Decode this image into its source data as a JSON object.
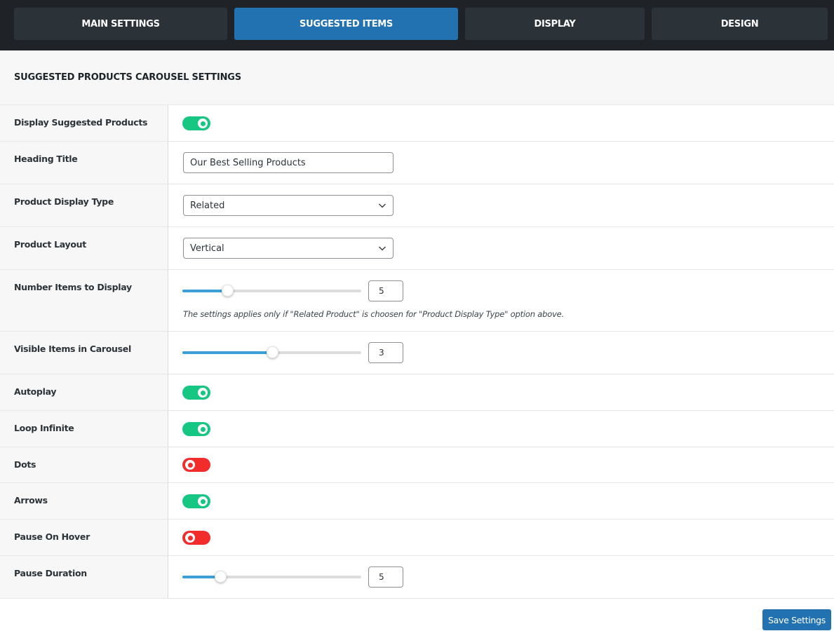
{
  "tabs": [
    {
      "label": "MAIN SETTINGS",
      "active": false
    },
    {
      "label": "SUGGESTED ITEMS",
      "active": true
    },
    {
      "label": "DISPLAY",
      "active": false
    },
    {
      "label": "DESIGN",
      "active": false
    }
  ],
  "colors": {
    "tab_bar": "#1f2327",
    "tab_inactive": "#2c3338",
    "tab_active": "#2271b1",
    "toggle_on": "#16c784",
    "toggle_off": "#f22b2b",
    "slider_fill": "#3ba0d8",
    "primary_button": "#2271b1"
  },
  "panel": {
    "title": "SUGGESTED PRODUCTS CAROUSEL SETTINGS"
  },
  "settings": {
    "display_suggested_products": {
      "label": "Display Suggested Products",
      "enabled": true
    },
    "heading_title": {
      "label": "Heading Title",
      "value": "Our Best Selling Products"
    },
    "product_display_type": {
      "label": "Product Display Type",
      "selected": "Related",
      "icon": "chevron-down-icon"
    },
    "product_layout": {
      "label": "Product Layout",
      "selected": "Vertical",
      "icon": "chevron-down-icon"
    },
    "number_items": {
      "label": "Number Items to Display",
      "value": "5",
      "slider_fraction": 0.25,
      "help": "The settings applies only if \"Related Product\" is choosen for \"Product Display Type\" option above."
    },
    "visible_items": {
      "label": "Visible Items in Carousel",
      "value": "3",
      "slider_fraction": 0.5
    },
    "autoplay": {
      "label": "Autoplay",
      "enabled": true
    },
    "loop_infinite": {
      "label": "Loop Infinite",
      "enabled": true
    },
    "dots": {
      "label": "Dots",
      "enabled": false
    },
    "arrows": {
      "label": "Arrows",
      "enabled": true
    },
    "pause_on_hover": {
      "label": "Pause On Hover",
      "enabled": false
    },
    "pause_duration": {
      "label": "Pause Duration",
      "value": "5",
      "slider_fraction": 0.21
    }
  },
  "footer": {
    "save_label": "Save Settings"
  }
}
